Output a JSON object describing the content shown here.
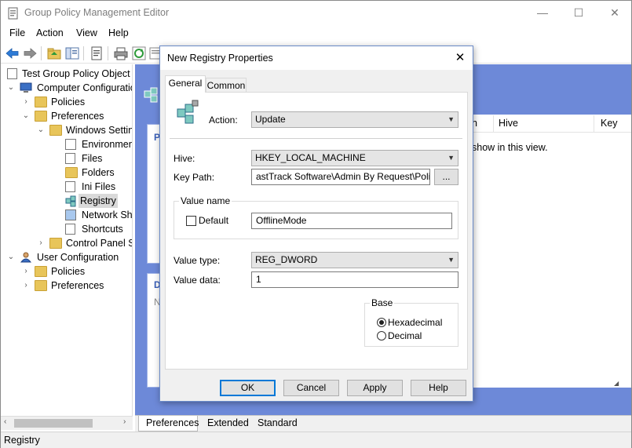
{
  "window": {
    "title": "Group Policy Management Editor",
    "minimize_glyph": "—",
    "maximize_glyph": "☐",
    "close_glyph": "✕"
  },
  "menu": [
    "File",
    "Action",
    "View",
    "Help"
  ],
  "tree": {
    "root": "Test Group Policy Object [l",
    "computer_config": "Computer Configuratio",
    "policies": "Policies",
    "preferences": "Preferences",
    "windows_settings": "Windows Settin",
    "items": [
      "Environmen",
      "Files",
      "Folders",
      "Ini Files",
      "Registry",
      "Network Sha",
      "Shortcuts"
    ],
    "control_panel": "Control Panel S",
    "user_config": "User Configuration",
    "user_policies": "Policies",
    "user_preferences": "Preferences"
  },
  "right_pane": {
    "card1_letter": "P",
    "card2_letter": "D",
    "card2_sub": "N",
    "columns": [
      "n",
      "Hive",
      "Key"
    ],
    "empty_text": "show in this view."
  },
  "bottom_tabs": [
    "Preferences",
    "Extended",
    "Standard"
  ],
  "status": "Registry",
  "dialog": {
    "title": "New Registry Properties",
    "close_glyph": "✕",
    "tabs": [
      "General",
      "Common"
    ],
    "action_label": "Action:",
    "action_value": "Update",
    "hive_label": "Hive:",
    "hive_value": "HKEY_LOCAL_MACHINE",
    "key_path_label": "Key Path:",
    "key_path_value": "astTrack Software\\Admin By Request\\Policies",
    "browse_label": "...",
    "value_name_group": "Value name",
    "default_label": "Default",
    "value_name": "OfflineMode",
    "value_type_label": "Value type:",
    "value_type": "REG_DWORD",
    "value_data_label": "Value data:",
    "value_data": "1",
    "base_group": "Base",
    "hex_label": "Hexadecimal",
    "dec_label": "Decimal",
    "buttons": [
      "OK",
      "Cancel",
      "Apply",
      "Help"
    ]
  }
}
